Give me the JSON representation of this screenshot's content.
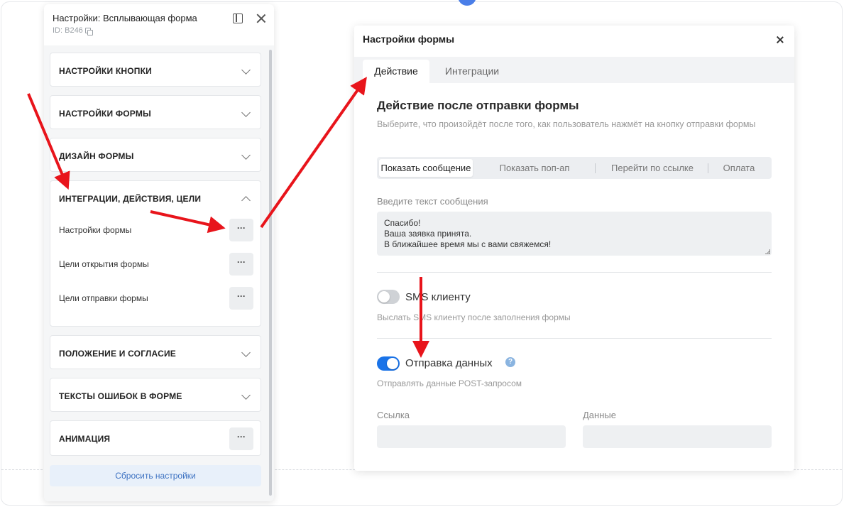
{
  "left_panel": {
    "title": "Настройки: Всплывающая форма",
    "id_label": "ID: B246",
    "sections": [
      {
        "label": "НАСТРОЙКИ КНОПКИ"
      },
      {
        "label": "НАСТРОЙКИ ФОРМЫ"
      },
      {
        "label": "ДИЗАЙН ФОРМЫ"
      },
      {
        "label": "ИНТЕГРАЦИИ, ДЕЙСТВИЯ, ЦЕЛИ",
        "items": [
          {
            "label": "Настройки формы",
            "button": "···"
          },
          {
            "label": "Цели открытия формы",
            "button": "···"
          },
          {
            "label": "Цели отправки формы",
            "button": "···"
          }
        ]
      },
      {
        "label": "ПОЛОЖЕНИЕ И СОГЛАСИЕ"
      },
      {
        "label": "ТЕКСТЫ ОШИБОК В ФОРМЕ"
      },
      {
        "label": "АНИМАЦИЯ",
        "button": "···"
      }
    ],
    "reset_label": "Сбросить настройки"
  },
  "modal": {
    "title": "Настройки формы",
    "tabs": [
      {
        "label": "Действие"
      },
      {
        "label": "Интеграции"
      }
    ],
    "section_title": "Действие после отправки формы",
    "section_desc": "Выберите, что произойдёт после того, как пользователь нажмёт на кнопку отправки формы",
    "segments": [
      {
        "label": "Показать сообщение"
      },
      {
        "label": "Показать поп-ап"
      },
      {
        "label": "Перейти по ссылке"
      },
      {
        "label": "Оплата"
      }
    ],
    "message_label": "Введите текст сообщения",
    "message_lines": [
      "Спасибо!",
      "Ваша заявка принята.",
      "В ближайшее время мы с вами свяжемся!"
    ],
    "sms": {
      "label": "SMS клиенту",
      "desc": "Выслать SMS клиенту после заполнения формы",
      "enabled": false
    },
    "send_data": {
      "label": "Отправка данных",
      "desc": "Отправлять данные POST-запросом",
      "enabled": true,
      "help": "?"
    },
    "link_label": "Ссылка",
    "data_label": "Данные"
  },
  "colors": {
    "accent": "#1a73e8",
    "annotation_arrow": "#e8141b",
    "reset_text": "#3d72c2"
  }
}
